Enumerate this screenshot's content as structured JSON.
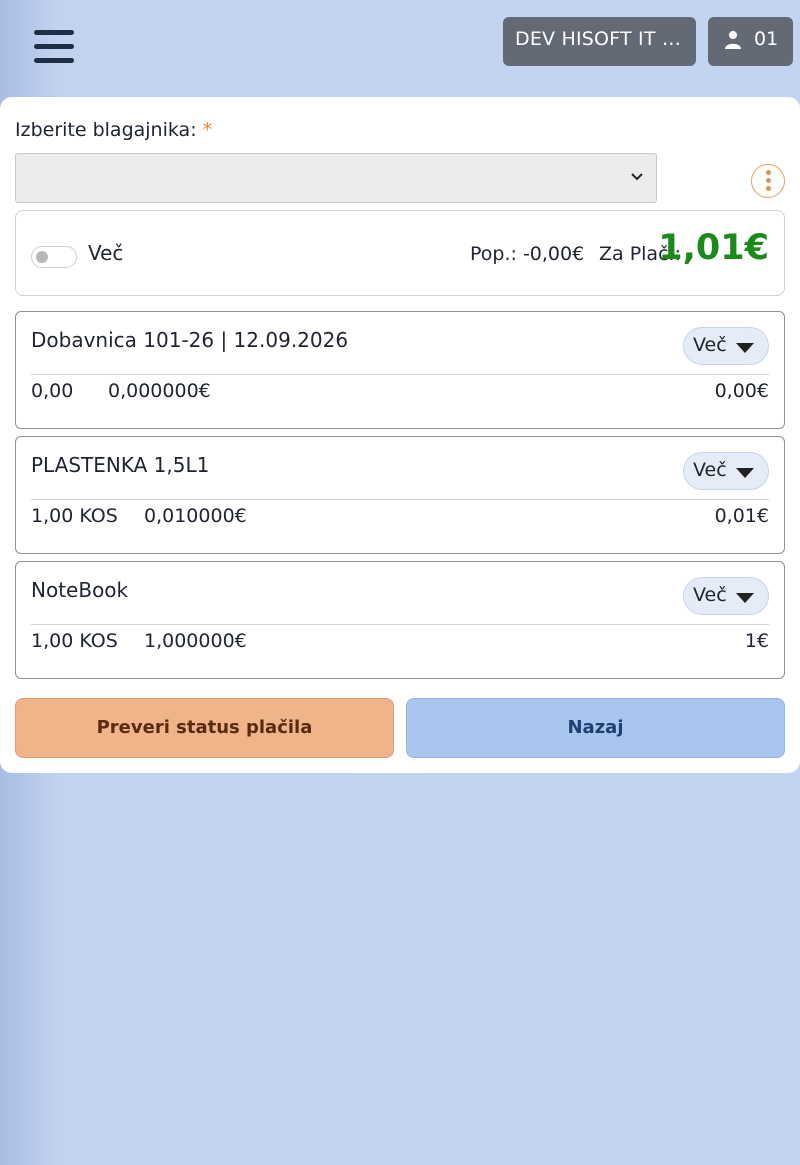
{
  "header": {
    "company": "DEV HISOFT IT I...",
    "user_number": "01"
  },
  "form": {
    "cashier_label": "Izberite blagajnika:",
    "required_mark": "*",
    "cashier_value": ""
  },
  "summary": {
    "toggle_label": "Več",
    "discount": "Pop.: -0,00€",
    "to_pay_label": "Za Plač.:",
    "total": "1,01€"
  },
  "items": [
    {
      "title": "Dobavnica 101-26 | 12.09.2026",
      "more_label": "Več",
      "qty": "0,00",
      "price": "0,000000€",
      "amount": "0,00€"
    },
    {
      "title": "PLASTENKA 1,5L1",
      "more_label": "Več",
      "qty": "1,00 KOS",
      "price": "0,010000€",
      "amount": "0,01€"
    },
    {
      "title": "NoteBook",
      "more_label": "Več",
      "qty": "1,00 KOS",
      "price": "1,000000€",
      "amount": "1€"
    }
  ],
  "buttons": {
    "check_status": "Preveri status plačila",
    "back": "Nazaj"
  },
  "icons": {
    "menu": "hamburger-menu-icon",
    "user": "user-icon",
    "dropdown": "chevron-down-icon",
    "options": "kebab-menu-icon",
    "expand": "caret-down-icon"
  },
  "colors": {
    "total": "#1a8a1a",
    "check_button": "#f0b48a",
    "back_button": "#a9c6ee",
    "header_button": "#636a75"
  }
}
